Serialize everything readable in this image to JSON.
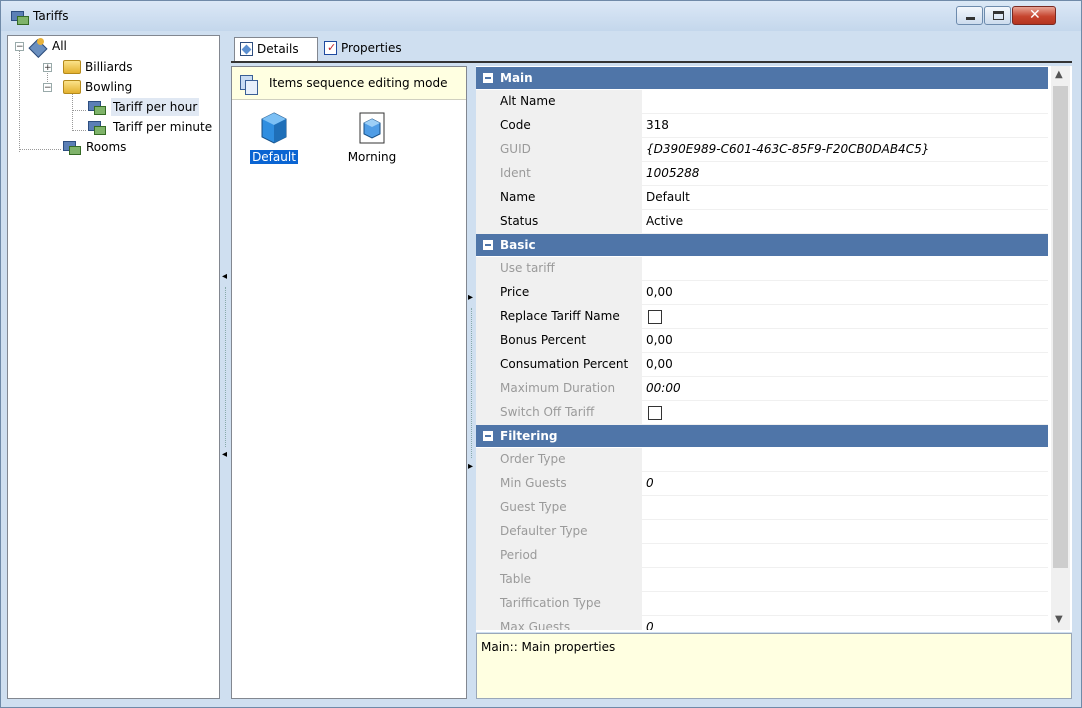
{
  "window": {
    "title": "Tariffs"
  },
  "tree": {
    "root": "All",
    "items": [
      {
        "label": "Billiards"
      },
      {
        "label": "Bowling"
      },
      {
        "label": "Tariff per hour"
      },
      {
        "label": "Tariff per minute"
      },
      {
        "label": "Rooms"
      }
    ]
  },
  "tabs": [
    {
      "label": "Details"
    },
    {
      "label": "Properties"
    }
  ],
  "items_panel": {
    "mode_label": "Items sequence editing mode",
    "items": [
      {
        "label": "Default"
      },
      {
        "label": "Morning"
      }
    ]
  },
  "grid": {
    "categories": [
      {
        "label": "Main",
        "rows": [
          {
            "name": "Alt Name",
            "value": ""
          },
          {
            "name": "Code",
            "value": "318"
          },
          {
            "name": "GUID",
            "value": "{D390E989-C601-463C-85F9-F20CB0DAB4C5}"
          },
          {
            "name": "Ident",
            "value": "1005288"
          },
          {
            "name": "Name",
            "value": "Default"
          },
          {
            "name": "Status",
            "value": "Active"
          }
        ]
      },
      {
        "label": "Basic",
        "rows": [
          {
            "name": "Use tariff",
            "value": ""
          },
          {
            "name": "Price",
            "value": "0,00"
          },
          {
            "name": "Replace Tariff Name",
            "value": ""
          },
          {
            "name": "Bonus Percent",
            "value": "0,00"
          },
          {
            "name": "Consumation Percent",
            "value": "0,00"
          },
          {
            "name": "Maximum Duration",
            "value": "00:00"
          },
          {
            "name": "Switch Off Tariff",
            "value": ""
          }
        ]
      },
      {
        "label": "Filtering",
        "rows": [
          {
            "name": "Order Type",
            "value": ""
          },
          {
            "name": "Min Guests",
            "value": "0"
          },
          {
            "name": "Guest Type",
            "value": ""
          },
          {
            "name": "Defaulter Type",
            "value": ""
          },
          {
            "name": "Period",
            "value": ""
          },
          {
            "name": "Table",
            "value": ""
          },
          {
            "name": "Tariffication Type",
            "value": ""
          },
          {
            "name": "Max Guests",
            "value": "0"
          }
        ]
      }
    ]
  },
  "description": "Main:: Main properties",
  "colors": {
    "category_header": "#4f75a8",
    "selection": "#0a64d2",
    "info_background": "#ffffe1"
  }
}
